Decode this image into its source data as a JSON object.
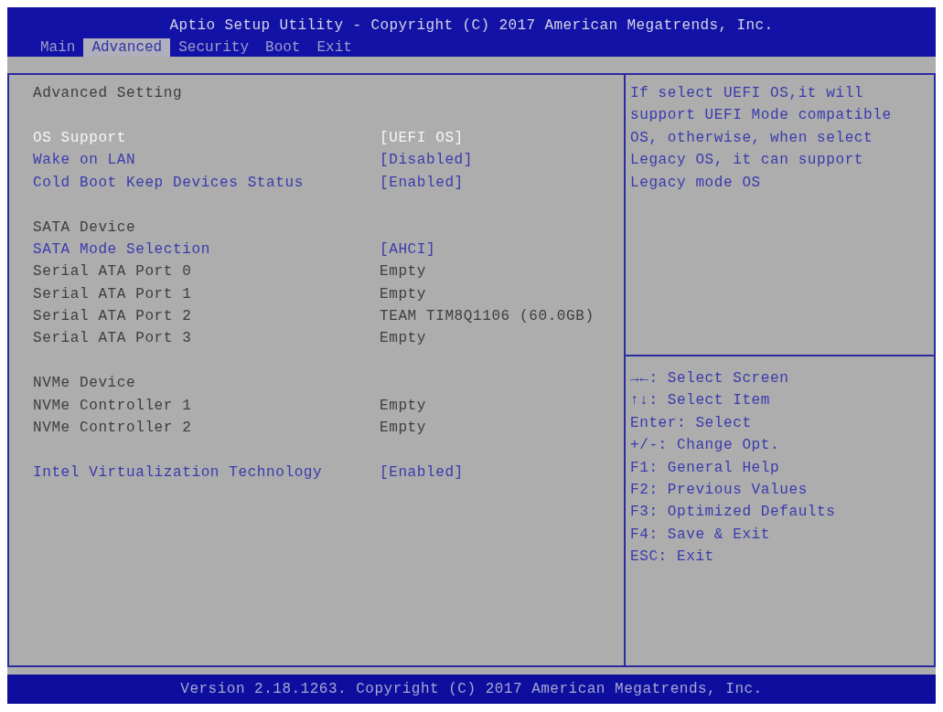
{
  "header": {
    "title": "Aptio Setup Utility - Copyright (C) 2017 American Megatrends, Inc.",
    "tabs": [
      {
        "label": "Main",
        "selected": false
      },
      {
        "label": "Advanced",
        "selected": true
      },
      {
        "label": "Security",
        "selected": false
      },
      {
        "label": "Boot",
        "selected": false
      },
      {
        "label": "Exit",
        "selected": false
      }
    ]
  },
  "settings": {
    "groups": [
      {
        "rows": [
          {
            "kind": "heading",
            "label": "Advanced Setting",
            "selected": false
          }
        ]
      },
      {
        "rows": [
          {
            "kind": "option",
            "label": "OS Support",
            "value": "[UEFI OS]",
            "selected": true
          },
          {
            "kind": "option",
            "label": "Wake on LAN",
            "value": "[Disabled]",
            "selected": false
          },
          {
            "kind": "option",
            "label": "Cold Boot Keep Devices Status",
            "value": "[Enabled]",
            "selected": false
          }
        ]
      },
      {
        "rows": [
          {
            "kind": "heading",
            "label": "SATA Device",
            "selected": false
          },
          {
            "kind": "option",
            "label": "SATA Mode Selection",
            "value": "[AHCI]",
            "selected": false
          },
          {
            "kind": "info",
            "label": "Serial ATA Port 0",
            "value": "Empty",
            "selected": false
          },
          {
            "kind": "info",
            "label": "Serial ATA Port 1",
            "value": "Empty",
            "selected": false
          },
          {
            "kind": "info",
            "label": "Serial ATA Port 2",
            "value": "TEAM TIM8Q1106 (60.0GB)",
            "selected": false
          },
          {
            "kind": "info",
            "label": "Serial ATA Port 3",
            "value": "Empty",
            "selected": false
          }
        ]
      },
      {
        "rows": [
          {
            "kind": "heading",
            "label": "NVMe Device",
            "selected": false
          },
          {
            "kind": "info",
            "label": "NVMe Controller 1",
            "value": "Empty",
            "selected": false
          },
          {
            "kind": "info",
            "label": "NVMe Controller 2",
            "value": "Empty",
            "selected": false
          }
        ]
      },
      {
        "rows": [
          {
            "kind": "option",
            "label": "Intel Virtualization Technology",
            "value": "[Enabled]",
            "selected": false
          }
        ]
      }
    ]
  },
  "help_panel": {
    "description": "If select UEFI OS,it will support UEFI Mode compatible OS, otherwise, when select Legacy OS, it can support Legacy mode OS",
    "key_help": [
      "→←: Select Screen",
      "↑↓: Select Item",
      "Enter: Select",
      "+/-: Change Opt.",
      "F1: General Help",
      "F2: Previous Values",
      "F3: Optimized Defaults",
      "F4: Save & Exit",
      "ESC: Exit"
    ]
  },
  "footer": {
    "text": "Version 2.18.1263. Copyright (C) 2017 American Megatrends, Inc."
  }
}
